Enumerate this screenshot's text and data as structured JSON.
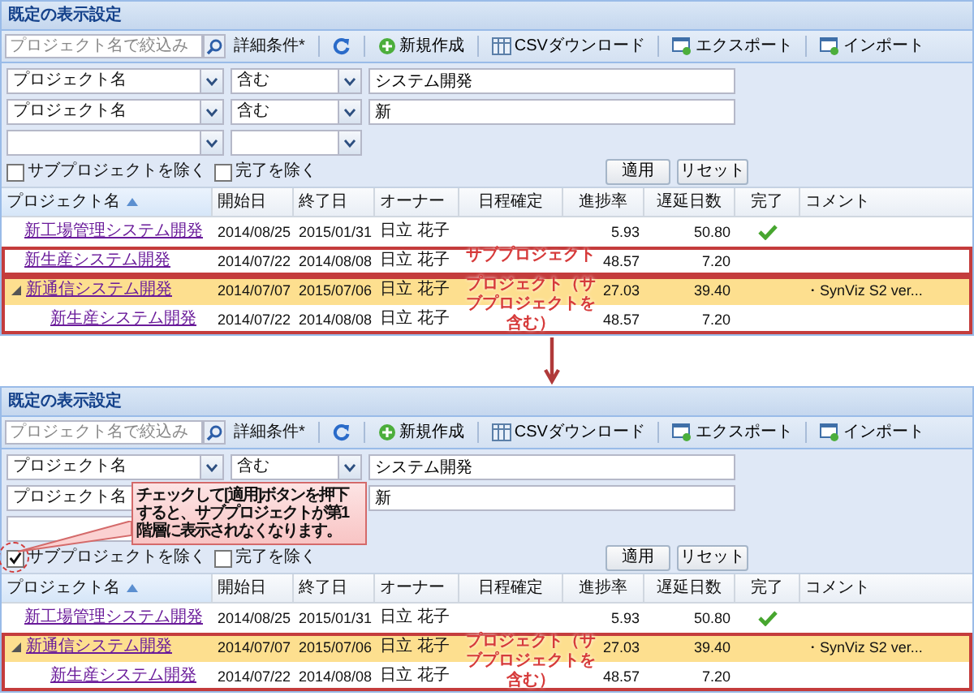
{
  "panels": [
    {
      "title": "既定の表示設定",
      "search": {
        "placeholder": "プロジェクト名で絞込み"
      },
      "advanced": "詳細条件*",
      "toolbar": [
        {
          "kind": "refresh"
        },
        {
          "kind": "new",
          "label": "新規作成"
        },
        {
          "kind": "csv",
          "label": "CSVダウンロード"
        },
        {
          "kind": "export",
          "label": "エクスポート"
        },
        {
          "kind": "import",
          "label": "インポート"
        }
      ],
      "filters": [
        {
          "field": "プロジェクト名",
          "operator": "含む",
          "value": "システム開発"
        },
        {
          "field": "プロジェクト名",
          "operator": "含む",
          "value": "新"
        }
      ],
      "blank_filter_row": true,
      "checkboxes": [
        {
          "label": "サブプロジェクトを除く",
          "checked": false
        },
        {
          "label": "完了を除く",
          "checked": false
        }
      ],
      "buttons": [
        "適用",
        "リセット"
      ],
      "columns": [
        {
          "label": "プロジェクト名",
          "sorted": true
        },
        {
          "label": "開始日",
          "sorted": false
        },
        {
          "label": "終了日",
          "sorted": false
        },
        {
          "label": "オーナー",
          "sorted": false
        },
        {
          "label": "日程確定",
          "sorted": false
        },
        {
          "label": "進捗率",
          "sorted": false
        },
        {
          "label": "遅延日数",
          "sorted": false
        },
        {
          "label": "完了",
          "sorted": false
        },
        {
          "label": "コメント",
          "sorted": false
        }
      ],
      "rows": [
        {
          "name": "新工場管理システム開発",
          "start": "2014/08/25",
          "end": "2015/01/31",
          "owner": "日立 花子",
          "progress": "5.93",
          "delay": "50.80",
          "done": true,
          "selected": false
        },
        {
          "name": "新生産システム開発",
          "start": "2014/07/22",
          "end": "2014/08/08",
          "owner": "日立 花子",
          "progress": "48.57",
          "delay": "7.20",
          "done": false,
          "selected": false,
          "annotation": "サブプロジェクト"
        },
        {
          "name": "新通信システム開発",
          "start": "2014/07/07",
          "end": "2015/07/06",
          "owner": "日立 花子",
          "progress": "27.03",
          "delay": "39.40",
          "done": false,
          "comment": "・SynViz S2 ver...",
          "selected": true,
          "expanded": true,
          "annotation": "プロジェクト（サブプロジェクトを含む）",
          "children": [
            {
              "name": "新生産システム開発",
              "start": "2014/07/22",
              "end": "2014/08/08",
              "owner": "日立 花子",
              "progress": "48.57",
              "delay": "7.20",
              "done": false,
              "selected": false
            }
          ]
        }
      ]
    },
    {
      "title": "既定の表示設定",
      "search": {
        "placeholder": "プロジェクト名で絞込み"
      },
      "advanced": "詳細条件*",
      "toolbar": [
        {
          "kind": "refresh"
        },
        {
          "kind": "new",
          "label": "新規作成"
        },
        {
          "kind": "csv",
          "label": "CSVダウンロード"
        },
        {
          "kind": "export",
          "label": "エクスポート"
        },
        {
          "kind": "import",
          "label": "インポート"
        }
      ],
      "filters": [
        {
          "field": "プロジェクト名",
          "operator": "含む",
          "value": "システム開発"
        },
        {
          "field": "プロジェクト名",
          "value": "新"
        }
      ],
      "blank_filter_row": true,
      "checkboxes": [
        {
          "label": "サブプロジェクトを除く",
          "checked": true,
          "callout": "チェックして[適用]ボタンを押下すると、サブプロジェクトが第1階層に表示されなくなります。"
        },
        {
          "label": "完了を除く",
          "checked": false
        }
      ],
      "buttons": [
        "適用",
        "リセット"
      ],
      "columns": [
        {
          "label": "プロジェクト名",
          "sorted": true
        },
        {
          "label": "開始日",
          "sorted": false
        },
        {
          "label": "終了日",
          "sorted": false
        },
        {
          "label": "オーナー",
          "sorted": false
        },
        {
          "label": "日程確定",
          "sorted": false
        },
        {
          "label": "進捗率",
          "sorted": false
        },
        {
          "label": "遅延日数",
          "sorted": false
        },
        {
          "label": "完了",
          "sorted": false
        },
        {
          "label": "コメント",
          "sorted": false
        }
      ],
      "rows": [
        {
          "name": "新工場管理システム開発",
          "start": "2014/08/25",
          "end": "2015/01/31",
          "owner": "日立 花子",
          "progress": "5.93",
          "delay": "50.80",
          "done": true,
          "selected": false
        },
        {
          "name": "新通信システム開発",
          "start": "2014/07/07",
          "end": "2015/07/06",
          "owner": "日立 花子",
          "progress": "27.03",
          "delay": "39.40",
          "done": false,
          "comment": "・SynViz S2 ver...",
          "selected": true,
          "expanded": true,
          "annotation": "プロジェクト（サブプロジェクトを含む）",
          "children": [
            {
              "name": "新生産システム開発",
              "start": "2014/07/22",
              "end": "2014/08/08",
              "owner": "日立 花子",
              "progress": "48.57",
              "delay": "7.20",
              "done": false,
              "selected": false
            }
          ]
        }
      ]
    }
  ]
}
